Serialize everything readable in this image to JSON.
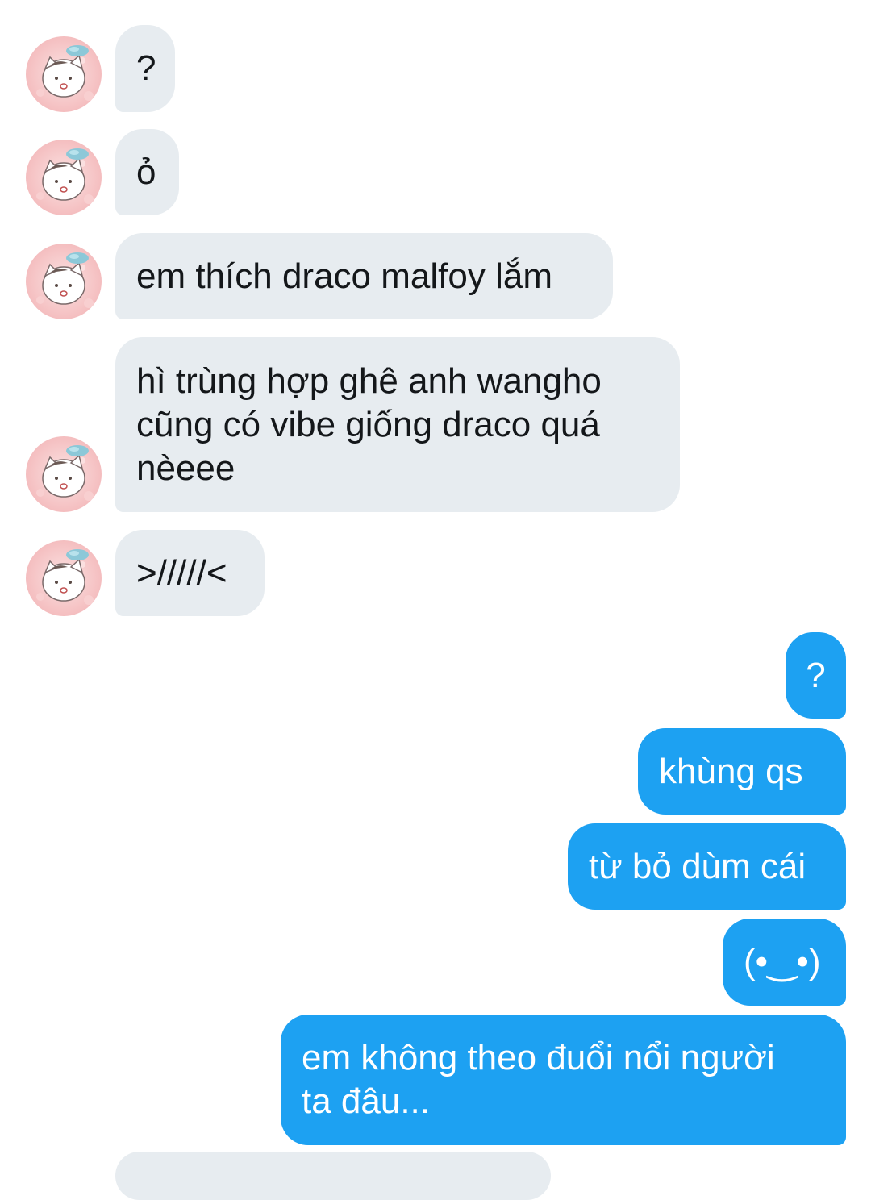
{
  "conversation": {
    "incoming": [
      {
        "text": "?",
        "avatar": "cat-avatar"
      },
      {
        "text": "ỏ",
        "avatar": "cat-avatar"
      },
      {
        "text": "em thích draco malfoy lắm",
        "avatar": "cat-avatar"
      },
      {
        "text": "hì trùng hợp ghê anh wangho\ncũng có vibe giống draco quá\nnèeee",
        "avatar": "cat-avatar"
      },
      {
        "text": ">/////<",
        "avatar": "cat-avatar"
      }
    ],
    "outgoing": [
      {
        "text": "?"
      },
      {
        "text": "khùng qs"
      },
      {
        "text": "từ bỏ dùm cái"
      },
      {
        "text": "(•‿•)"
      },
      {
        "text": "em không theo đuổi nổi người\nta đâu..."
      }
    ]
  },
  "colors": {
    "incoming_bubble": "#e7ecf0",
    "incoming_text": "#14171a",
    "outgoing_bubble": "#1da1f2",
    "outgoing_text": "#ffffff",
    "background": "#ffffff"
  }
}
